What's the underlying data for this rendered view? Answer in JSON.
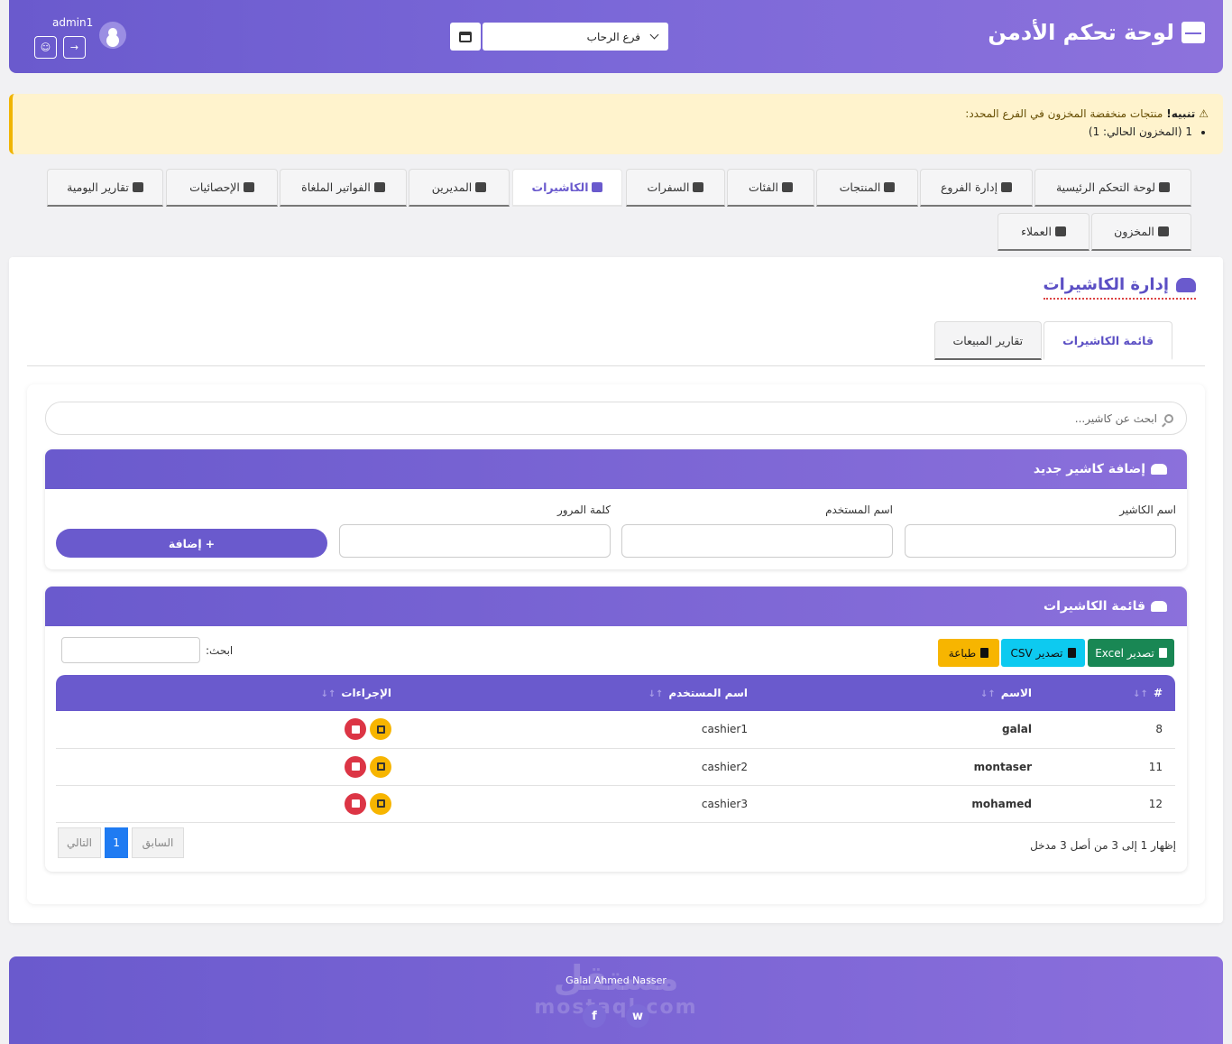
{
  "header": {
    "title": "لوحة تحكم الأدمن",
    "branch_value": "فرع الرحاب",
    "username": "admin1"
  },
  "alert": {
    "title": "تنبيه!",
    "message": "منتجات منخفضة المخزون في الفرع المحدد:",
    "items": [
      "1 (المخزون الحالي: 1)"
    ]
  },
  "nav": {
    "tabs": [
      "لوحة التحكم الرئيسية",
      "إدارة الفروع",
      "المنتجات",
      "الفئات",
      "السفرات",
      "الكاشيرات",
      "المديرين",
      "الفواتير الملغاة",
      "الإحصائيات",
      "تقارير اليومية",
      "المخزون",
      "العملاء"
    ],
    "active": "الكاشيرات"
  },
  "page": {
    "title": "إدارة الكاشيرات",
    "subtabs": [
      "قائمة الكاشيرات",
      "تقارير المبيعات"
    ]
  },
  "search": {
    "placeholder": "ابحث عن كاشير..."
  },
  "add_form": {
    "header": "إضافة كاشير جديد",
    "name_label": "اسم الكاشير",
    "username_label": "اسم المستخدم",
    "password_label": "كلمة المرور",
    "submit": "إضافة"
  },
  "list": {
    "header": "قائمة الكاشيرات",
    "export_excel": "تصدير Excel",
    "export_csv": "تصدير CSV",
    "print": "طباعة",
    "search_label": "ابحث:",
    "columns": [
      "#",
      "الاسم",
      "اسم المستخدم",
      "الإجراءات"
    ],
    "rows": [
      {
        "id": "8",
        "name": "galal",
        "username": "cashier1"
      },
      {
        "id": "11",
        "name": "montaser",
        "username": "cashier2"
      },
      {
        "id": "12",
        "name": "mohamed",
        "username": "cashier3"
      }
    ],
    "info": "إظهار 1 إلى 3 من أصل 3 مدخل",
    "prev": "السابق",
    "page": "1",
    "next": "التالي"
  },
  "footer": {
    "name": "Galal Ahmed Nasser",
    "watermark": "مستقل",
    "watermark_sub": "mostaql.com",
    "social": [
      "f",
      "w"
    ]
  },
  "colors": {
    "primary": "#6a5acd",
    "warning": "#f7b500",
    "danger": "#dc3545",
    "info": "#0dcaf0",
    "success": "#198754"
  }
}
